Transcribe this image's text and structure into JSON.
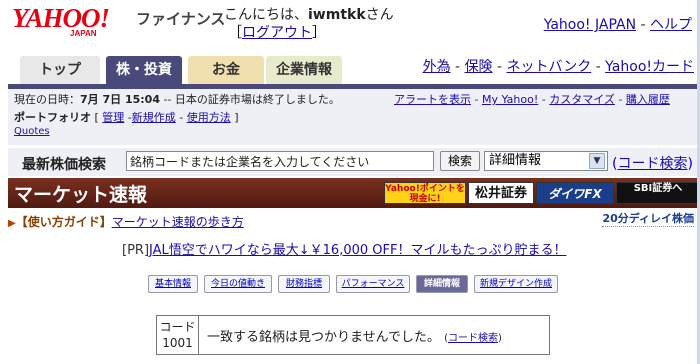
{
  "header": {
    "logo_text": "YAHOO!",
    "logo_sub": "JAPAN",
    "service_name": "ファイナンス",
    "greeting_prefix": "こんにちは、",
    "username": "iwmtkk",
    "greeting_suffix": "さん",
    "logout_open": "［",
    "logout": "ログアウト",
    "logout_close": "］",
    "links": [
      "Yahoo! JAPAN",
      "ヘルプ"
    ],
    "links_sep": " - "
  },
  "tabs": [
    "トップ",
    "株・投資",
    "お金",
    "企業情報"
  ],
  "tab_links": [
    "外為",
    "保険",
    "ネットバンク",
    "Yahoo!カード"
  ],
  "info": {
    "date_label": "現在の日時：",
    "date_value": "7月 7日 15:04",
    "market_status": " -- 日本の証券市場は終了しました。",
    "links": [
      "アラートを表示",
      "My Yahoo!",
      "カスタマイズ",
      "購入履歴"
    ],
    "portfolio_label": "ポートフォリオ",
    "portfolio_links": [
      "管理",
      "新規作成",
      "使用方法"
    ],
    "quotes": "Quotes"
  },
  "search": {
    "label": "最新株価検索",
    "placeholder": "銘柄コードまたは企業名を入力してください",
    "button": "検索",
    "select_value": "詳細情報",
    "code_search": "コード検索"
  },
  "market": {
    "title": "マーケット速報",
    "ads": [
      "Yahoo!ポイントを現金に!",
      "松井証券",
      "ダイワFX",
      "SBI証券へ"
    ]
  },
  "guide": {
    "tri": "▶",
    "label": "【使い方ガイド】",
    "link": "マーケット速報の歩き方",
    "delay": "20分ディレイ株価"
  },
  "pr": {
    "prefix": "[PR]",
    "text": "JAL悟空でハワイなら最大↓￥16,000 OFF！マイルもたっぷり貯まる！"
  },
  "subtabs": [
    "基本情報",
    "今日の値動き",
    "財務指標",
    "パフォーマンス",
    "詳細情報",
    "新規デザイン作成"
  ],
  "result": {
    "code_label": "コード",
    "code_value": "1001",
    "message": "一致する銘柄は見つかりませんでした。",
    "link": "コード検索"
  },
  "colors": {
    "brand_red": "#e60012",
    "tab_active": "#4a4a7a",
    "market_bar": "#6a2a1a",
    "link": "#0000cc"
  }
}
